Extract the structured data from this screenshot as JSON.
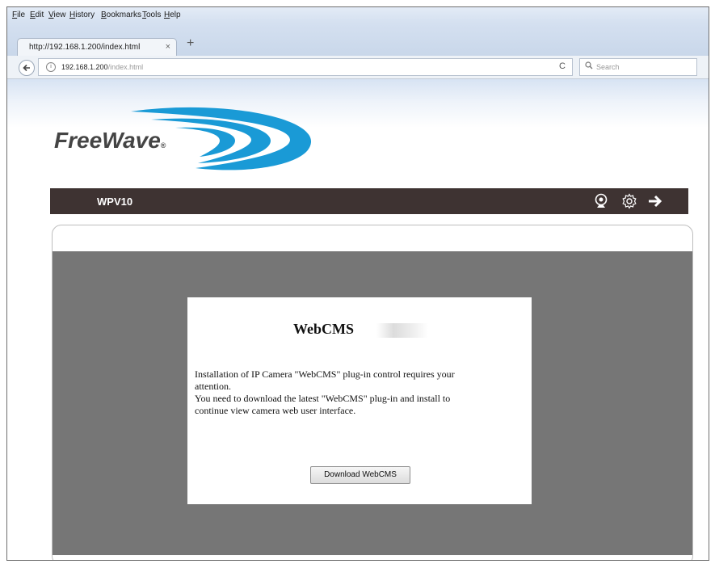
{
  "browser": {
    "menu": [
      "File",
      "Edit",
      "View",
      "History",
      "Bookmarks",
      "Tools",
      "Help"
    ],
    "tab": {
      "title": "http://192.168.1.200/index.html",
      "close": "×"
    },
    "new_tab": "+",
    "nav": {
      "back": "🡐",
      "info": "i",
      "url_host": "192.168.1.200",
      "url_path": "/index.html",
      "reload": "C",
      "search_placeholder": "Search"
    }
  },
  "page": {
    "logo": {
      "text": "FreeWave",
      "mark": "®",
      "swoosh_color": "#1a9ad6"
    },
    "header": {
      "title": "WPV10",
      "icons": [
        "webcam-icon",
        "gear-icon",
        "logout-arrow-icon"
      ],
      "bg_color": "#3e3332"
    },
    "dialog": {
      "title": "WebCMS",
      "line1": "Installation of IP Camera \"WebCMS\" plug-in control requires your",
      "line2": "attention.",
      "line3": "You need to download the latest \"WebCMS\" plug-in and install to",
      "line4": "continue view camera web user interface.",
      "button": "Download WebCMS"
    }
  }
}
